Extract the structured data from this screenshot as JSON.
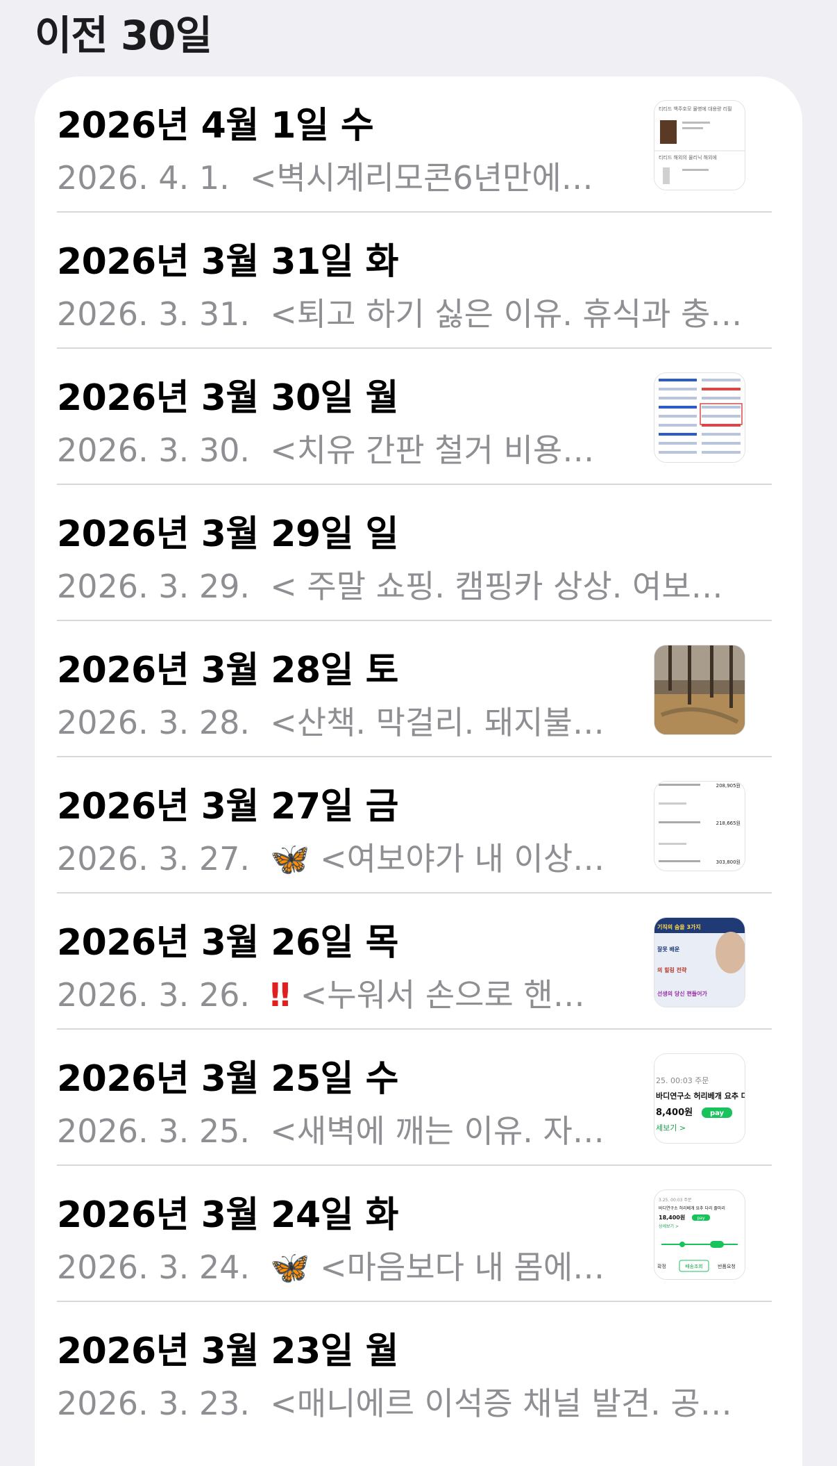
{
  "section": {
    "title": "이전 30일"
  },
  "rows": [
    {
      "title": "2026년 4월 1일 수",
      "date": "2026. 4. 1.",
      "marker": "",
      "preview": "<벽시계리모콘6년만에…",
      "thumb": "doc-list"
    },
    {
      "title": "2026년 3월 31일 화",
      "date": "2026. 3. 31.",
      "marker": "",
      "preview": "<퇴고 하기 싫은 이유. 휴식과 충…",
      "thumb": ""
    },
    {
      "title": "2026년 3월 30일 월",
      "date": "2026. 3. 30.",
      "marker": "",
      "preview": "<치유 간판 철거 비용…",
      "thumb": "form"
    },
    {
      "title": "2026년 3월 29일 일",
      "date": "2026. 3. 29.",
      "marker": "",
      "preview": "< 주말 쇼핑. 캠핑카 상상. 여보…",
      "thumb": ""
    },
    {
      "title": "2026년 3월 28일 토",
      "date": "2026. 3. 28.",
      "marker": "",
      "preview": "<산책. 막걸리. 돼지불…",
      "thumb": "photo"
    },
    {
      "title": "2026년 3월 27일 금",
      "date": "2026. 3. 27.",
      "marker": "🦋",
      "preview": "<여보야가 내 이상…",
      "thumb": "receipt"
    },
    {
      "title": "2026년 3월 26일 목",
      "date": "2026. 3. 26.",
      "marker": "‼",
      "preview": "<누워서 손으로 핸…",
      "thumb": "video"
    },
    {
      "title": "2026년 3월 25일 수",
      "date": "2026. 3. 25.",
      "marker": "",
      "preview": "<새벽에 깨는 이유. 자…",
      "thumb": "order"
    },
    {
      "title": "2026년 3월 24일 화",
      "date": "2026. 3. 24.",
      "marker": "🦋",
      "preview": "<마음보다 내 몸에…",
      "thumb": "delivery"
    },
    {
      "title": "2026년 3월 23일 월",
      "date": "2026. 3. 23.",
      "marker": "",
      "preview": "<매니에르 이석증 채널 발견. 공…",
      "thumb": ""
    }
  ],
  "thumb_text": {
    "order_time": "25. 00:03 주문",
    "order_item": "바디연구소 허리베개 요추 다",
    "order_price": "8,400원",
    "order_pay": "pay",
    "order_link": "세보기 >",
    "delivery_time": "3.25. 00:03 주문",
    "delivery_item": "바디연구소 허리베개 요추 다리 줄마리",
    "delivery_price": "18,400원",
    "delivery_pay": "pay",
    "delivery_link": "상세보기 >",
    "delivery_btn1": "배송조회",
    "delivery_btn2": "반품요청",
    "delivery_tag": "확정",
    "video_line1": "기직의 숨을 3가지",
    "video_line2": "잘못 배운",
    "video_line3": "의 힐링 전략",
    "video_line4": "선생의 당신 편들어가",
    "doc_line1": "티티드 백주호모 물병에 대용량 리필",
    "doc_line2": "티티드 해외의 물리닉 해외에",
    "receipt_amount1": "208,905원",
    "receipt_amount2": "218,665원",
    "receipt_amount3": "303,800원"
  }
}
